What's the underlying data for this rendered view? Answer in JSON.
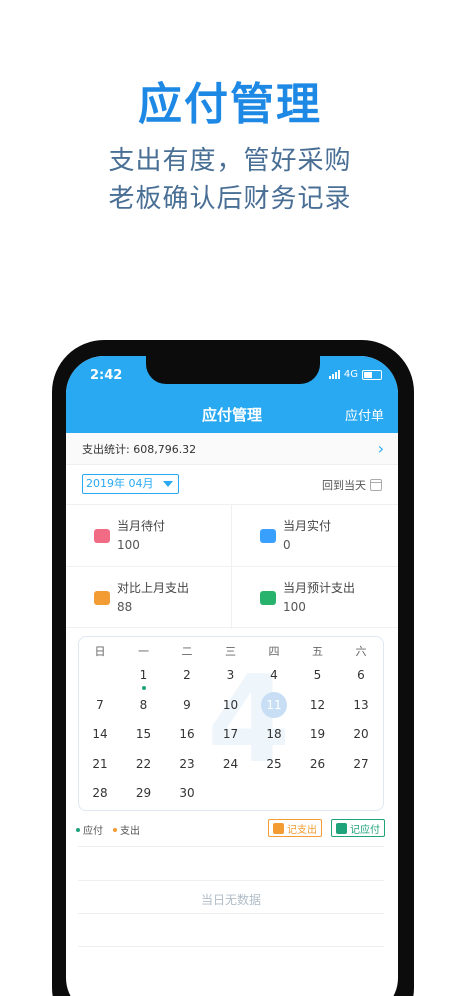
{
  "hero": {
    "title": "应付管理",
    "subtitle1": "支出有度，管好采购",
    "subtitle2": "老板确认后财务记录"
  },
  "status_bar": {
    "time": "2:42",
    "network": "4G"
  },
  "nav": {
    "title": "应付管理",
    "right_action": "应付单"
  },
  "summary": {
    "label": "支出统计: 608,796.32"
  },
  "month_picker": {
    "value": "2019年 04月"
  },
  "today_button": "回到当天",
  "stats": [
    {
      "label": "当月待付",
      "value": "100",
      "icon": "wallet-icon",
      "color": "#f26b85"
    },
    {
      "label": "当月实付",
      "value": "0",
      "icon": "card-icon",
      "color": "#3aa0ff"
    },
    {
      "label": "对比上月支出",
      "value": "88",
      "icon": "money-bag-icon",
      "color": "#f39c33"
    },
    {
      "label": "当月预计支出",
      "value": "100",
      "icon": "cash-icon",
      "color": "#27b36c"
    }
  ],
  "calendar": {
    "weekdays": [
      "日",
      "一",
      "二",
      "三",
      "四",
      "五",
      "六"
    ],
    "month_watermark": "4",
    "today": 11,
    "days": [
      [
        "",
        "1",
        "2",
        "3",
        "4",
        "5",
        "6"
      ],
      [
        "7",
        "8",
        "9",
        "10",
        "11",
        "12",
        "13"
      ],
      [
        "14",
        "15",
        "16",
        "17",
        "18",
        "19",
        "20"
      ],
      [
        "21",
        "22",
        "23",
        "24",
        "25",
        "26",
        "27"
      ],
      [
        "28",
        "29",
        "30",
        "",
        "",
        "",
        ""
      ]
    ],
    "marked_days": [
      1
    ]
  },
  "legend": {
    "payable": "应付",
    "expense": "支出",
    "payable_color": "#1fa37b",
    "expense_color": "#f39c33"
  },
  "actions": {
    "record_expense": "记支出",
    "record_payable": "记应付"
  },
  "empty_state": "当日无数据"
}
